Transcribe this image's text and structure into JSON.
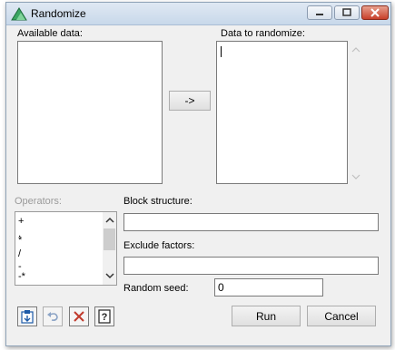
{
  "window": {
    "title": "Randomize"
  },
  "labels": {
    "available_data": "Available data:",
    "data_to_randomize": "Data to randomize:",
    "operators": "Operators:",
    "block_structure": "Block structure:",
    "exclude_factors": "Exclude factors:",
    "random_seed": "Random seed:"
  },
  "buttons": {
    "add": "->",
    "run": "Run",
    "cancel": "Cancel"
  },
  "operators": [
    "+",
    ".",
    "*",
    "/",
    "-",
    "-*"
  ],
  "fields": {
    "block_structure": "",
    "exclude_factors": "",
    "random_seed": "0"
  },
  "icons": [
    "window-app-icon",
    "copy-to-clipboard-icon",
    "undo-icon",
    "clear-icon",
    "help-icon"
  ],
  "colors": {
    "title_bar": "#c8d8ea",
    "close_button": "#c8402a",
    "clear_x": "#c0392b",
    "disabled_text": "#9a9a9a"
  }
}
